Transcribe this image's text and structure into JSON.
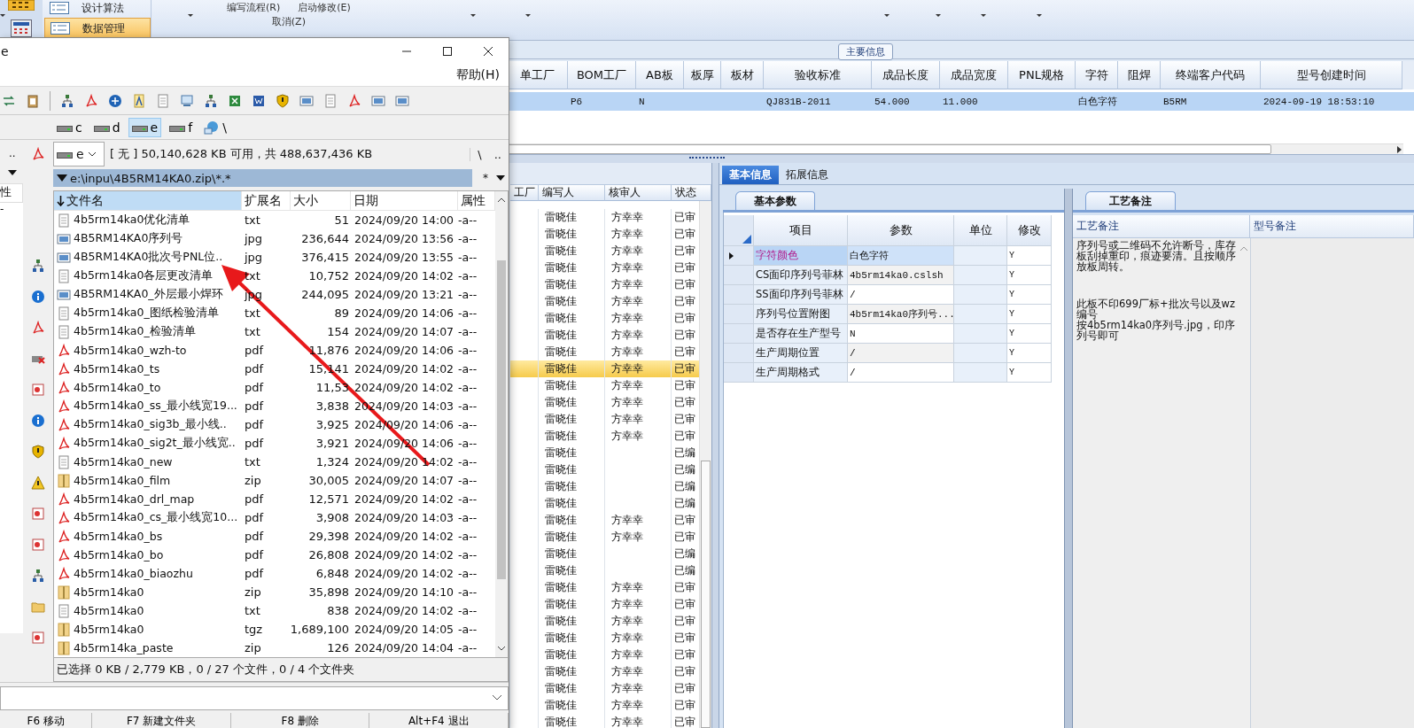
{
  "ribbon": {
    "buttons": [
      {
        "label": "设计算法",
        "selected": false
      },
      {
        "label": "数据管理",
        "selected": true
      }
    ],
    "commands": [
      "编写流程(R)",
      "启动修改(E)",
      "取消(Z)"
    ],
    "group_title": "主要信息"
  },
  "main_grid": {
    "columns": [
      "单工厂",
      "BOM工厂",
      "AB板",
      "板厚",
      "板材",
      "验收标准",
      "成品长度",
      "成品宽度",
      "PNL规格",
      "字符",
      "阻焊",
      "终端客户代码",
      "型号创建时间"
    ],
    "rows": [
      {
        "cells": [
          null,
          "P6",
          "N",
          null,
          null,
          "QJ831B-2011",
          "54.000",
          "11.000",
          null,
          "白色字符",
          null,
          "B5RM",
          "2024-09-19 18:53:10"
        ],
        "selected": true
      }
    ]
  },
  "review_grid": {
    "columns": [
      "工厂",
      "编写人",
      "核审人",
      "状态"
    ],
    "rows": [
      {
        "writer": "雷晓佳",
        "reviewer": "方幸幸",
        "status": "已审",
        "selected": false
      },
      {
        "writer": "雷晓佳",
        "reviewer": "方幸幸",
        "status": "已审",
        "selected": false
      },
      {
        "writer": "雷晓佳",
        "reviewer": "方幸幸",
        "status": "已审",
        "selected": false
      },
      {
        "writer": "雷晓佳",
        "reviewer": "方幸幸",
        "status": "已审",
        "selected": false
      },
      {
        "writer": "雷晓佳",
        "reviewer": "方幸幸",
        "status": "已审",
        "selected": false
      },
      {
        "writer": "雷晓佳",
        "reviewer": "方幸幸",
        "status": "已审",
        "selected": false
      },
      {
        "writer": "雷晓佳",
        "reviewer": "方幸幸",
        "status": "已审",
        "selected": false
      },
      {
        "writer": "雷晓佳",
        "reviewer": "方幸幸",
        "status": "已审",
        "selected": false
      },
      {
        "writer": "雷晓佳",
        "reviewer": "方幸幸",
        "status": "已审",
        "selected": false
      },
      {
        "writer": "雷晓佳",
        "reviewer": "方幸幸",
        "status": "已审",
        "selected": true
      },
      {
        "writer": "雷晓佳",
        "reviewer": "方幸幸",
        "status": "已审",
        "selected": false
      },
      {
        "writer": "雷晓佳",
        "reviewer": "方幸幸",
        "status": "已审",
        "selected": false
      },
      {
        "writer": "雷晓佳",
        "reviewer": "方幸幸",
        "status": "已审",
        "selected": false
      },
      {
        "writer": "雷晓佳",
        "reviewer": "方幸幸",
        "status": "已审",
        "selected": false
      },
      {
        "writer": "雷晓佳",
        "status": "已编",
        "selected": false
      },
      {
        "writer": "雷晓佳",
        "status": "已编",
        "selected": false
      },
      {
        "writer": "雷晓佳",
        "status": "已编",
        "selected": false
      },
      {
        "writer": "雷晓佳",
        "status": "已编",
        "selected": false
      },
      {
        "writer": "雷晓佳",
        "reviewer": "方幸幸",
        "status": "已审",
        "selected": false
      },
      {
        "writer": "雷晓佳",
        "reviewer": "方幸幸",
        "status": "已审",
        "selected": false
      },
      {
        "writer": "雷晓佳",
        "status": "已编",
        "selected": false
      },
      {
        "writer": "雷晓佳",
        "status": "已编",
        "selected": false
      },
      {
        "writer": "雷晓佳",
        "reviewer": "方幸幸",
        "status": "已审",
        "selected": false
      },
      {
        "writer": "雷晓佳",
        "reviewer": "方幸幸",
        "status": "已审",
        "selected": false
      },
      {
        "writer": "雷晓佳",
        "reviewer": "方幸幸",
        "status": "已审",
        "selected": false
      },
      {
        "writer": "雷晓佳",
        "reviewer": "方幸幸",
        "status": "已审",
        "selected": false
      },
      {
        "writer": "雷晓佳",
        "reviewer": "方幸幸",
        "status": "已审",
        "selected": false
      },
      {
        "writer": "雷晓佳",
        "reviewer": "方幸幸",
        "status": "已审",
        "selected": false
      },
      {
        "writer": "雷晓佳",
        "reviewer": "方幸幸",
        "status": "已审",
        "selected": false
      },
      {
        "writer": "雷晓佳",
        "reviewer": "方幸幸",
        "status": "已审",
        "selected": false
      },
      {
        "writer": "雷晓佳",
        "reviewer": "方幸幸",
        "status": "已审",
        "selected": false
      }
    ]
  },
  "detail_panel": {
    "tabs": [
      {
        "label": "基本信息",
        "selected": true
      },
      {
        "label": "拓展信息",
        "selected": false
      }
    ],
    "params": {
      "tab": "基本参数",
      "columns": [
        "项目",
        "参数",
        "单位",
        "修改"
      ],
      "rows": [
        {
          "item": "字符颜色",
          "value": "白色字符",
          "modify": "Y",
          "selected": true
        },
        {
          "item": "CS面印序列号菲林",
          "value": "4b5rm14ka0.cslsh",
          "modify": "Y",
          "selected": false
        },
        {
          "item": "SS面印序列号菲林",
          "value": "/",
          "modify": "Y",
          "selected": false
        },
        {
          "item": "序列号位置附图",
          "value": "4b5rm14ka0序列号...",
          "modify": "Y",
          "selected": false
        },
        {
          "item": "是否存在生产型号",
          "value": "N",
          "modify": "Y",
          "selected": false
        },
        {
          "item": "生产周期位置",
          "value": "/",
          "modify": "Y",
          "selected": false
        },
        {
          "item": "生产周期格式",
          "value": "/",
          "modify": "Y",
          "selected": false
        }
      ]
    },
    "notes": {
      "tab": "工艺备注",
      "columns": [
        "工艺备注",
        "型号备注"
      ],
      "paragraphs": [
        "序列号或二维码不允许断号，库存板刮掉重印，痕迹要清。且按顺序放板周转。",
        "此板不印699厂标+批次号以及wz编号",
        "按4b5rm14ka0序列号.jpg，印序列号即可"
      ]
    }
  },
  "file_manager": {
    "title": "e",
    "menu": [
      "帮助(H)"
    ],
    "drives": [
      {
        "label": "c",
        "selected": false
      },
      {
        "label": "d",
        "selected": false
      },
      {
        "label": "e",
        "selected": true
      },
      {
        "label": "f",
        "selected": false
      },
      {
        "label": "\\",
        "selected": false
      }
    ],
    "left_panel": {
      "up": "..",
      "header": "性",
      "item": "-"
    },
    "drive_select": "e",
    "free_space": "[ 无 ]  50,140,628 KB 可用，共 488,637,436 KB",
    "nav": [
      "\\",
      ".."
    ],
    "path": "e:\\inpu\\4B5RM14KA0.zip\\*.*",
    "filter": "*",
    "columns": [
      {
        "label": "文件名",
        "sorted": true
      },
      {
        "label": "扩展名",
        "sorted": false
      },
      {
        "label": "大小",
        "sorted": false
      },
      {
        "label": "日期",
        "sorted": false
      },
      {
        "label": "属性",
        "sorted": false
      }
    ],
    "files": [
      {
        "kind": "text",
        "name": "4b5rm14ka0优化清单",
        "ext": "txt",
        "size": "51",
        "date": "2024/09/20 14:00",
        "attr": "-a--"
      },
      {
        "kind": "image",
        "name": "4B5RM14KA0序列号",
        "ext": "jpg",
        "size": "236,644",
        "date": "2024/09/20 13:56",
        "attr": "-a--"
      },
      {
        "kind": "image",
        "name": "4B5RM14KA0批次号PNL位..",
        "ext": "jpg",
        "size": "376,415",
        "date": "2024/09/20 13:55",
        "attr": "-a--"
      },
      {
        "kind": "text",
        "name": "4b5rm14ka0各层更改清单",
        "ext": "txt",
        "size": "10,752",
        "date": "2024/09/20 14:02",
        "attr": "-a--"
      },
      {
        "kind": "image",
        "name": "4B5RM14KA0_外层最小焊环",
        "ext": "jpg",
        "size": "244,095",
        "date": "2024/09/20 13:21",
        "attr": "-a--"
      },
      {
        "kind": "text",
        "name": "4b5rm14ka0_图纸检验清单",
        "ext": "txt",
        "size": "89",
        "date": "2024/09/20 14:06",
        "attr": "-a--"
      },
      {
        "kind": "text",
        "name": "4b5rm14ka0_检验清单",
        "ext": "txt",
        "size": "154",
        "date": "2024/09/20 14:07",
        "attr": "-a--"
      },
      {
        "kind": "pdf",
        "name": "4b5rm14ka0_wzh-to",
        "ext": "pdf",
        "size": "11,876",
        "date": "2024/09/20 14:06",
        "attr": "-a--"
      },
      {
        "kind": "pdf",
        "name": "4b5rm14ka0_ts",
        "ext": "pdf",
        "size": "15,141",
        "date": "2024/09/20 14:02",
        "attr": "-a--"
      },
      {
        "kind": "pdf",
        "name": "4b5rm14ka0_to",
        "ext": "pdf",
        "size": "11,53",
        "date": "2024/09/20 14:02",
        "attr": "-a--"
      },
      {
        "kind": "pdf",
        "name": "4b5rm14ka0_ss_最小线宽19...",
        "ext": "pdf",
        "size": "3,838",
        "date": "2024/09/20 14:03",
        "attr": "-a--"
      },
      {
        "kind": "pdf",
        "name": "4b5rm14ka0_sig3b_最小线..",
        "ext": "pdf",
        "size": "3,925",
        "date": "2024/09/20 14:06",
        "attr": "-a--"
      },
      {
        "kind": "pdf",
        "name": "4b5rm14ka0_sig2t_最小线宽..",
        "ext": "pdf",
        "size": "3,921",
        "date": "2024/09/20 14:06",
        "attr": "-a--"
      },
      {
        "kind": "text",
        "name": "4b5rm14ka0_new",
        "ext": "txt",
        "size": "1,324",
        "date": "2024/09/20 14:02",
        "attr": "-a--"
      },
      {
        "kind": "archive",
        "name": "4b5rm14ka0_film",
        "ext": "zip",
        "size": "30,005",
        "date": "2024/09/20 14:07",
        "attr": "-a--"
      },
      {
        "kind": "pdf",
        "name": "4b5rm14ka0_drl_map",
        "ext": "pdf",
        "size": "12,571",
        "date": "2024/09/20 14:02",
        "attr": "-a--"
      },
      {
        "kind": "pdf",
        "name": "4b5rm14ka0_cs_最小线宽10...",
        "ext": "pdf",
        "size": "3,908",
        "date": "2024/09/20 14:03",
        "attr": "-a--"
      },
      {
        "kind": "pdf",
        "name": "4b5rm14ka0_bs",
        "ext": "pdf",
        "size": "29,398",
        "date": "2024/09/20 14:02",
        "attr": "-a--"
      },
      {
        "kind": "pdf",
        "name": "4b5rm14ka0_bo",
        "ext": "pdf",
        "size": "26,808",
        "date": "2024/09/20 14:02",
        "attr": "-a--"
      },
      {
        "kind": "pdf",
        "name": "4b5rm14ka0_biaozhu",
        "ext": "pdf",
        "size": "6,848",
        "date": "2024/09/20 14:02",
        "attr": "-a--"
      },
      {
        "kind": "archive",
        "name": "4b5rm14ka0",
        "ext": "zip",
        "size": "35,898",
        "date": "2024/09/20 14:10",
        "attr": "-a--"
      },
      {
        "kind": "text",
        "name": "4b5rm14ka0",
        "ext": "txt",
        "size": "838",
        "date": "2024/09/20 14:02",
        "attr": "-a--"
      },
      {
        "kind": "archive",
        "name": "4b5rm14ka0",
        "ext": "tgz",
        "size": "1,689,100",
        "date": "2024/09/20 14:05",
        "attr": "-a--"
      },
      {
        "kind": "archive",
        "name": "4b5rm14ka_paste",
        "ext": "zip",
        "size": "126",
        "date": "2024/09/20 14:04",
        "attr": "-a--"
      }
    ],
    "status": "已选择 0 KB / 2,779 KB，0 / 27 个文件，0 / 4 个文件夹",
    "function_keys": [
      "F6 移动",
      "F7 新建文件夹",
      "F8 删除",
      "Alt+F4 退出"
    ]
  }
}
